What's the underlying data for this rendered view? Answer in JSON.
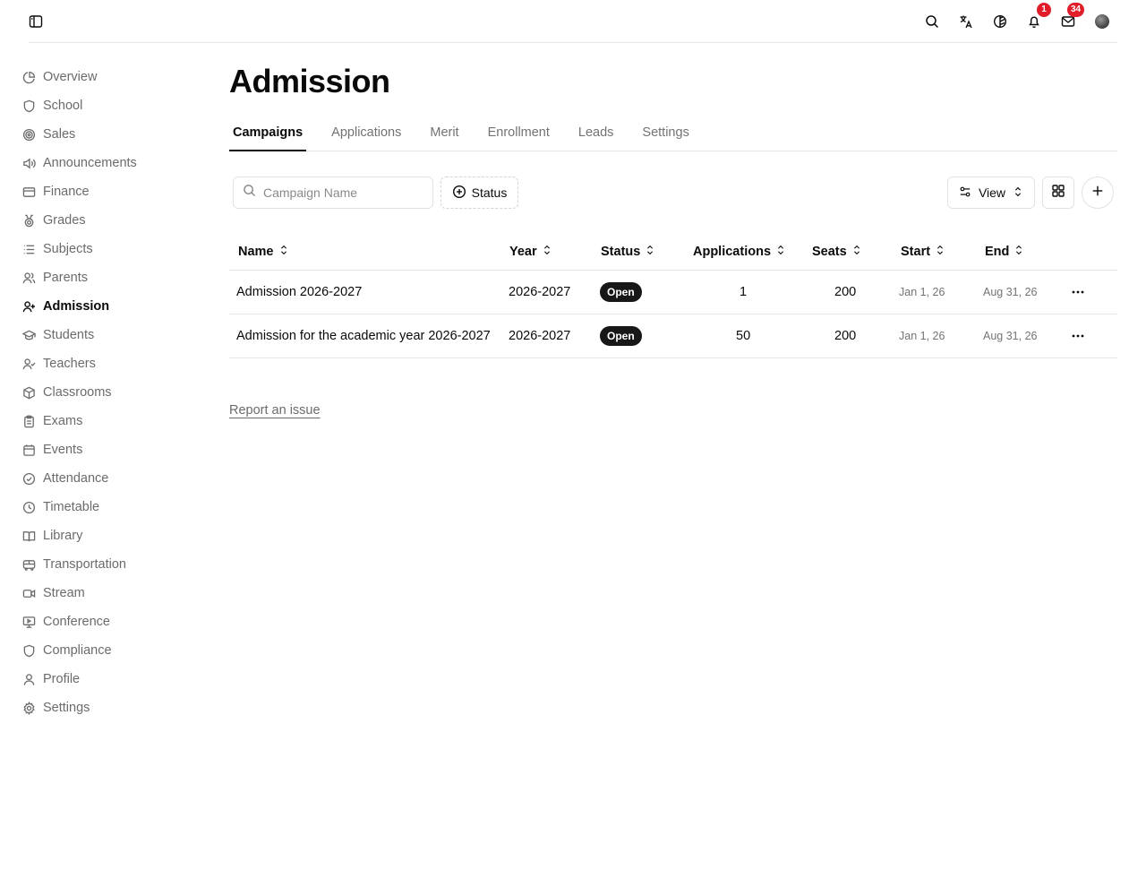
{
  "topbar": {
    "notifications_count": "1",
    "messages_count": "34"
  },
  "sidebar": {
    "items": [
      {
        "label": "Overview",
        "icon": "pie-chart-icon"
      },
      {
        "label": "School",
        "icon": "shield-icon"
      },
      {
        "label": "Sales",
        "icon": "target-icon"
      },
      {
        "label": "Announcements",
        "icon": "megaphone-icon"
      },
      {
        "label": "Finance",
        "icon": "credit-card-icon"
      },
      {
        "label": "Grades",
        "icon": "medal-icon"
      },
      {
        "label": "Subjects",
        "icon": "list-icon"
      },
      {
        "label": "Parents",
        "icon": "users-icon"
      },
      {
        "label": "Admission",
        "icon": "user-plus-icon",
        "active": true
      },
      {
        "label": "Students",
        "icon": "graduation-cap-icon"
      },
      {
        "label": "Teachers",
        "icon": "user-check-icon"
      },
      {
        "label": "Classrooms",
        "icon": "box-icon"
      },
      {
        "label": "Exams",
        "icon": "clipboard-icon"
      },
      {
        "label": "Events",
        "icon": "calendar-icon"
      },
      {
        "label": "Attendance",
        "icon": "check-circle-icon"
      },
      {
        "label": "Timetable",
        "icon": "clock-icon"
      },
      {
        "label": "Library",
        "icon": "book-open-icon"
      },
      {
        "label": "Transportation",
        "icon": "bus-icon"
      },
      {
        "label": "Stream",
        "icon": "video-icon"
      },
      {
        "label": "Conference",
        "icon": "presentation-icon"
      },
      {
        "label": "Compliance",
        "icon": "shield-icon"
      },
      {
        "label": "Profile",
        "icon": "user-icon"
      },
      {
        "label": "Settings",
        "icon": "gear-icon"
      }
    ]
  },
  "main": {
    "title": "Admission",
    "tabs": [
      {
        "label": "Campaigns",
        "active": true
      },
      {
        "label": "Applications"
      },
      {
        "label": "Merit"
      },
      {
        "label": "Enrollment"
      },
      {
        "label": "Leads"
      },
      {
        "label": "Settings"
      }
    ],
    "search": {
      "placeholder": "Campaign Name",
      "value": ""
    },
    "status_filter_label": "Status",
    "view_label": "View",
    "table": {
      "columns": [
        "Name",
        "Year",
        "Status",
        "Applications",
        "Seats",
        "Start",
        "End"
      ],
      "rows": [
        {
          "name": "Admission 2026-2027",
          "year": "2026-2027",
          "status": "Open",
          "applications": "1",
          "seats": "200",
          "start": "Jan 1, 26",
          "end": "Aug 31, 26"
        },
        {
          "name": "Admission for the academic year 2026-2027",
          "year": "2026-2027",
          "status": "Open",
          "applications": "50",
          "seats": "200",
          "start": "Jan 1, 26",
          "end": "Aug 31, 26"
        }
      ]
    },
    "report_link": "Report an issue"
  },
  "colors": {
    "accent": "#0a0a0a",
    "muted_text": "#6b6b6b",
    "badge_red": "#e11d2a",
    "pill_bg": "#171717"
  }
}
